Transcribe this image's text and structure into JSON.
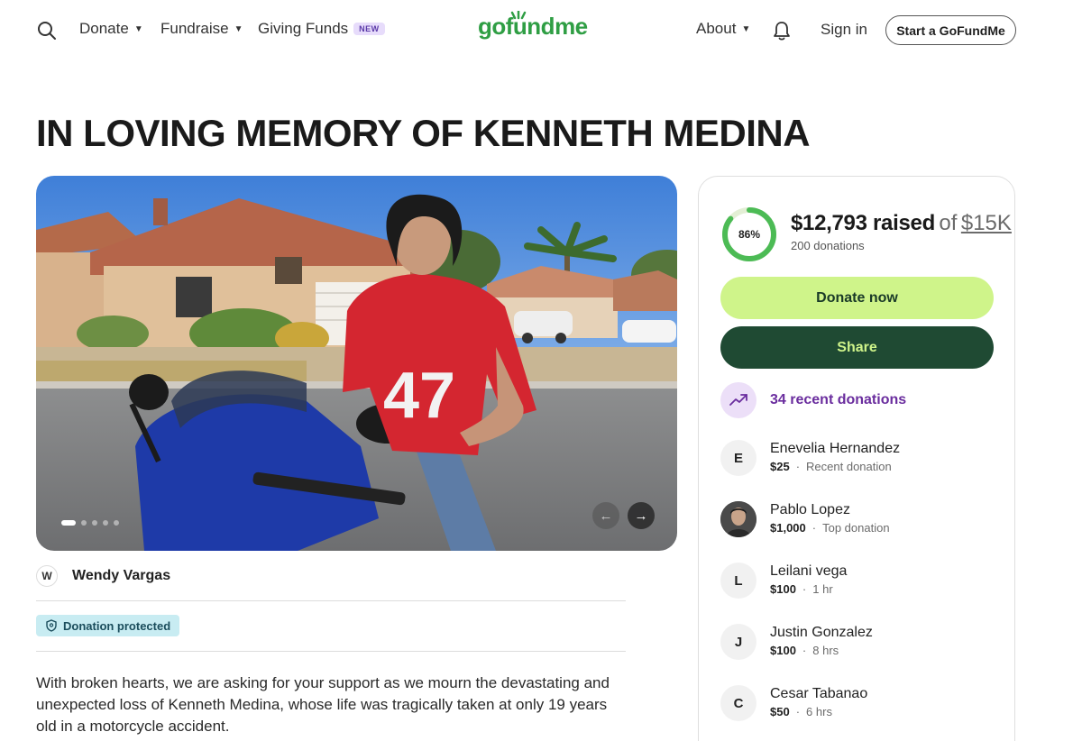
{
  "header": {
    "nav": {
      "donate": "Donate",
      "fundraise": "Fundraise",
      "giving_funds": "Giving Funds",
      "new_badge": "NEW",
      "about": "About"
    },
    "logo_text": "gofundme",
    "sign_in": "Sign in",
    "start_button": "Start a GoFundMe",
    "brand_color": "#2f9e44",
    "icons": [
      "search-icon",
      "bell-icon"
    ]
  },
  "page_title": "IN LOVING MEMORY OF KENNETH MEDINA",
  "photo": {
    "jersey_number": "47",
    "carousel_position": 1,
    "arrows": {
      "prev": "←",
      "next": "→"
    }
  },
  "organizer": {
    "initial": "W",
    "name": "Wendy Vargas"
  },
  "protection_badge": "Donation protected",
  "story": "With broken hearts, we are asking for your support as we mourn the devastating and unexpected loss of Kenneth Medina, whose life was tragically taken at only 19 years old in a motorcycle accident.",
  "fundraiser": {
    "progress_percent": 86,
    "progress_label": "86%",
    "raised_amount": "$12,793 raised",
    "of_text": "of",
    "goal": "$15K",
    "donation_count": "200 donations",
    "donate_button": "Donate now",
    "share_button": "Share",
    "recent_donations": "34 recent donations",
    "accent_color": "#cff48a",
    "dark_color": "#1f4a33",
    "purple_color": "#6a2d9e"
  },
  "donors": [
    {
      "initial": "E",
      "name": "Enevelia Hernandez",
      "amount": "$25",
      "note": "Recent donation"
    },
    {
      "initial": "",
      "name": "Pablo Lopez",
      "amount": "$1,000",
      "note": "Top donation"
    },
    {
      "initial": "L",
      "name": "Leilani vega",
      "amount": "$100",
      "note": "1 hr"
    },
    {
      "initial": "J",
      "name": "Justin Gonzalez",
      "amount": "$100",
      "note": "8 hrs"
    },
    {
      "initial": "C",
      "name": "Cesar Tabanao",
      "amount": "$50",
      "note": "6 hrs"
    }
  ]
}
